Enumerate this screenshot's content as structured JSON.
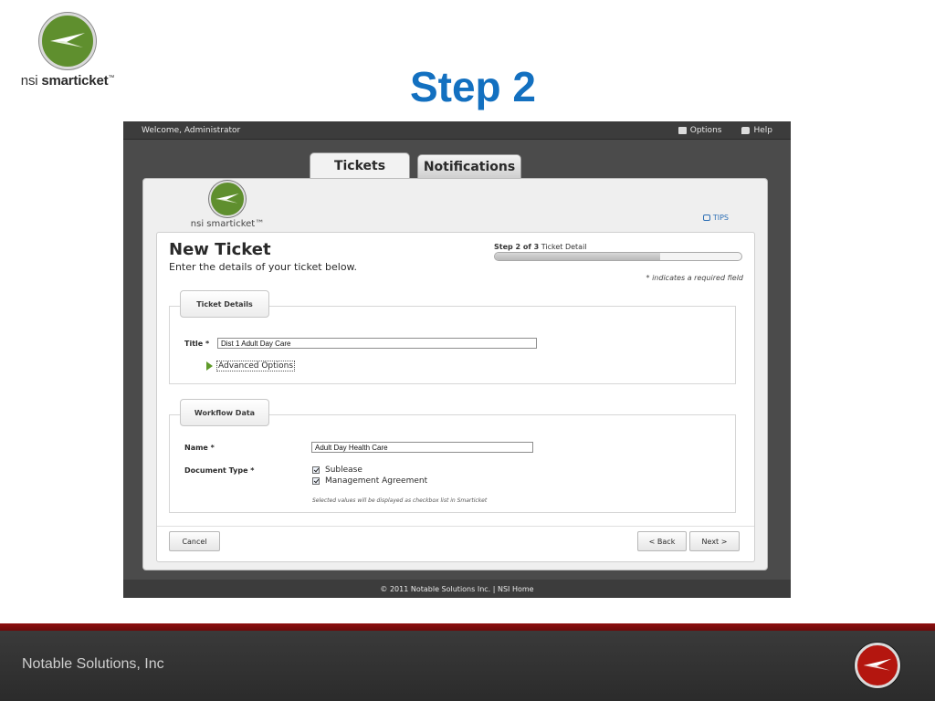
{
  "brand": {
    "name_light": "nsi",
    "name_bold": "smarticket",
    "trademark": "™"
  },
  "slide": {
    "title": "Step 2"
  },
  "topbar": {
    "welcome": "Welcome, Administrator",
    "options_label": "Options",
    "help_label": "Help"
  },
  "tabs": [
    {
      "label": "Tickets",
      "active": true
    },
    {
      "label": "Notifications",
      "active": false
    }
  ],
  "panel": {
    "brand": "nsi smarticket™",
    "tips_label": "TIPS"
  },
  "form": {
    "title": "New Ticket",
    "subtitle": "Enter the details of your ticket below.",
    "step_prefix": "Step 2 of 3",
    "step_name": "Ticket Detail",
    "progress": 0.67,
    "required_note": "* indicates a required field"
  },
  "ticket_details": {
    "legend": "Ticket Details",
    "title_label": "Title *",
    "title_value": "Dist 1 Adult Day Care",
    "advanced_options": "Advanced Options"
  },
  "workflow": {
    "legend": "Workflow Data",
    "name_label": "Name *",
    "name_value": "Adult Day Health Care",
    "doc_type_label": "Document Type *",
    "doc_types": [
      {
        "label": "Sublease",
        "checked": true
      },
      {
        "label": "Management Agreement",
        "checked": true
      }
    ],
    "hint": "Selected values will be displayed as checkbox list in Smarticket"
  },
  "buttons": {
    "cancel": "Cancel",
    "back": "< Back",
    "next": "Next >"
  },
  "footer": {
    "text": "© 2011 Notable Solutions Inc. | NSI Home"
  },
  "company": "Notable Solutions, Inc",
  "colors": {
    "title_blue": "#1370c0",
    "brand_green": "#5f8f2e",
    "brand_red": "#b4160f"
  }
}
